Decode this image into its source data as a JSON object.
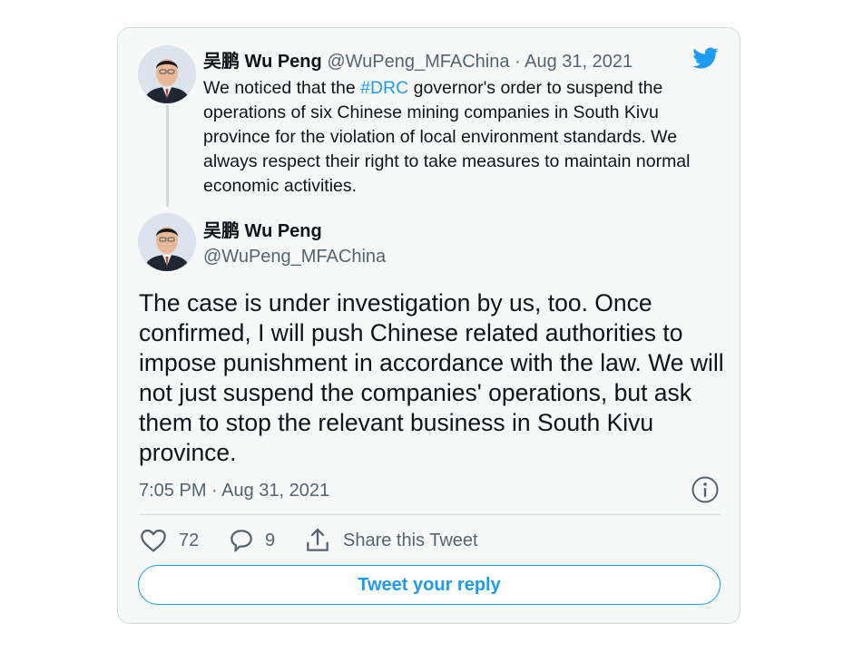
{
  "colors": {
    "accent": "#1d9bf0",
    "text": "#0f1419",
    "muted": "#536471",
    "border": "#cfd9de",
    "card_background": "#f7f9f9"
  },
  "icons": {
    "brand": "twitter-bird-icon",
    "info": "info-icon",
    "like": "heart-icon",
    "reply": "reply-bubble-icon",
    "share": "share-icon"
  },
  "quoted_tweet": {
    "display_name": "吴鹏 Wu Peng",
    "handle": "@WuPeng_MFAChina",
    "separator": " · ",
    "date": "Aug 31, 2021",
    "text_before_hashtag": "We noticed that the ",
    "hashtag": "#DRC",
    "text_after_hashtag": " governor's order to suspend the operations of six Chinese mining companies in South Kivu province for the violation of local environment standards. We always respect their right to take measures to maintain normal economic activities."
  },
  "main_tweet": {
    "display_name": "吴鹏 Wu Peng",
    "handle": "@WuPeng_MFAChina",
    "text": "The case is under investigation by us, too. Once confirmed, I will push Chinese related authorities to impose punishment in accordance with the law. We will not just suspend the companies' operations, but ask them to stop the relevant business in South Kivu province.",
    "timestamp": "7:05 PM · Aug 31, 2021"
  },
  "actions": {
    "likes": "72",
    "replies": "9",
    "share_label": "Share this Tweet"
  },
  "reply_button_label": "Tweet your reply"
}
